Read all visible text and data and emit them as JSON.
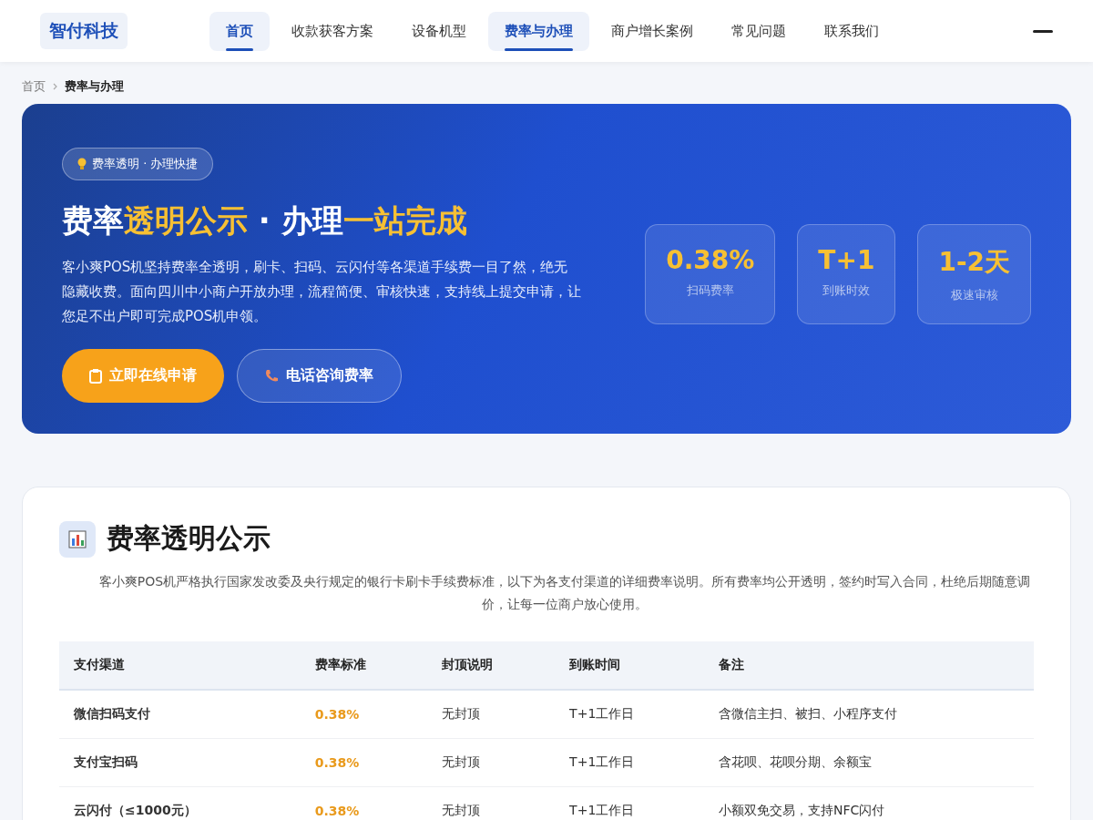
{
  "header": {
    "logo": "智付科技",
    "nav": [
      {
        "label": "首页",
        "selected": true
      },
      {
        "label": "收款获客方案",
        "selected": false
      },
      {
        "label": "设备机型",
        "selected": false
      },
      {
        "label": "费率与办理",
        "selected": true
      },
      {
        "label": "商户增长案例",
        "selected": false
      },
      {
        "label": "常见问题",
        "selected": false
      },
      {
        "label": "联系我们",
        "selected": false
      }
    ]
  },
  "breadcrumb": [
    {
      "label": "首页",
      "selected": false
    },
    {
      "label": "费率与办理",
      "selected": true
    }
  ],
  "hero": {
    "tag": "费率透明 · 办理快捷",
    "title": [
      {
        "text": "费率",
        "highlight": false
      },
      {
        "text": "透明公示",
        "highlight": true
      },
      {
        "text": " · 办理",
        "highlight": false
      },
      {
        "text": "一站完成",
        "highlight": true
      }
    ],
    "description": "客小爽POS机坚持费率全透明，刷卡、扫码、云闪付等各渠道手续费一目了然，绝无隐藏收费。面向四川中小商户开放办理，流程简便、审核快速，支持线上提交申请，让您足不出户即可完成POS机申领。",
    "buttons": [
      {
        "label": "立即在线申请",
        "kind": "primary"
      },
      {
        "label": "电话咨询费率",
        "kind": "secondary"
      }
    ],
    "stats": [
      {
        "value": "0.38%",
        "label": "扫码费率"
      },
      {
        "value": "T+1",
        "label": "到账时效"
      },
      {
        "value": "1-2天",
        "label": "极速审核"
      }
    ]
  },
  "section": {
    "title": "费率透明公示",
    "intro": "客小爽POS机严格执行国家发改委及央行规定的银行卡刷卡手续费标准，以下为各支付渠道的详细费率说明。所有费率均公开透明，签约时写入合同，杜绝后期随意调价，让每一位商户放心使用。",
    "table": {
      "columns": [
        "支付渠道",
        "费率标准",
        "封顶说明",
        "到账时间",
        "备注"
      ],
      "rows": [
        [
          "微信扫码支付",
          "0.38%",
          "无封顶",
          "T+1工作日",
          "含微信主扫、被扫、小程序支付"
        ],
        [
          "支付宝扫码",
          "0.38%",
          "无封顶",
          "T+1工作日",
          "含花呗、花呗分期、余额宝"
        ],
        [
          "云闪付（≤1000元）",
          "0.38%",
          "无封顶",
          "T+1工作日",
          "小额双免交易，支持NFC闪付"
        ]
      ]
    }
  }
}
